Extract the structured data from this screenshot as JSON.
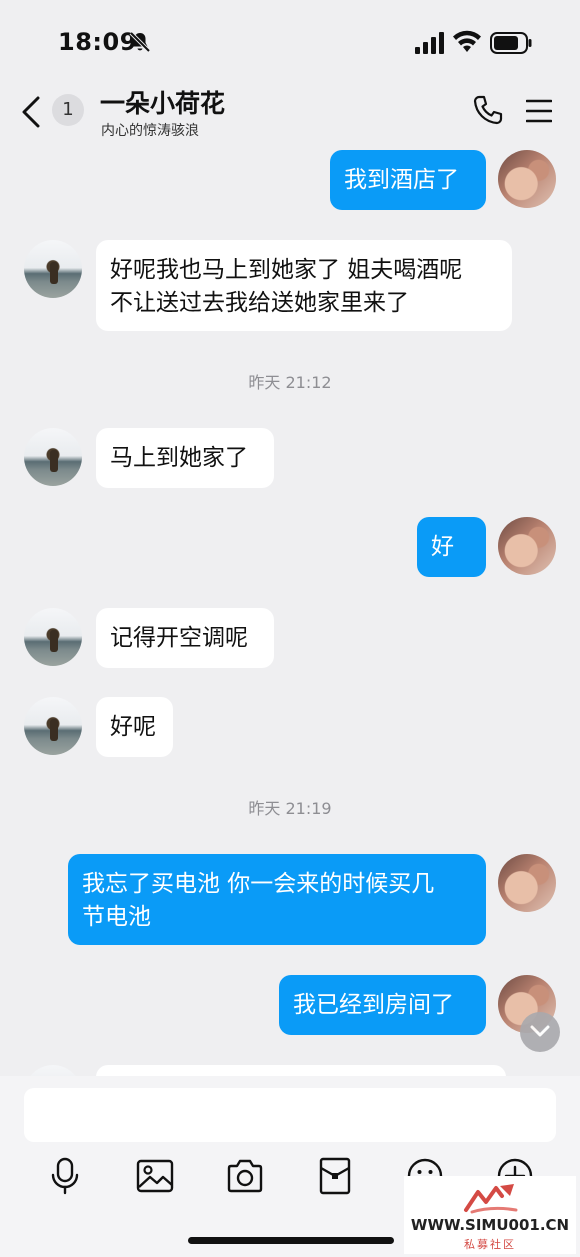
{
  "status_bar": {
    "time": "18:09"
  },
  "header": {
    "unread_count": "1",
    "contact_name": "一朵小荷花",
    "contact_signature": "内心的惊涛骇浪"
  },
  "messages": [
    {
      "side": "out",
      "text": "我到酒店了"
    },
    {
      "side": "in",
      "text": "好呢我也马上到她家了 姐夫喝酒呢\n不让送过去我给送她家里来了"
    },
    {
      "side": "time",
      "text": "昨天 21:12"
    },
    {
      "side": "in",
      "text": "马上到她家了"
    },
    {
      "side": "out",
      "text": "好"
    },
    {
      "side": "in",
      "text": "记得开空调呢"
    },
    {
      "side": "in",
      "text": "好呢"
    },
    {
      "side": "time",
      "text": "昨天 21:19"
    },
    {
      "side": "out",
      "text": "我忘了买电池 你一会来的时候买几\n节电池"
    },
    {
      "side": "out",
      "text": "我已经到房间了"
    }
  ],
  "composer": {
    "input_value": ""
  },
  "toolbar": {
    "icons": [
      "microphone-icon",
      "image-icon",
      "camera-icon",
      "red-packet-icon",
      "emoji-icon",
      "plus-icon"
    ]
  },
  "watermark": {
    "site": "WWW.SIMU001.CN",
    "sub": "私募社区"
  },
  "colors": {
    "outgoing_bubble": "#0a9bf7",
    "incoming_bubble": "#ffffff",
    "background": "#efeff1"
  }
}
